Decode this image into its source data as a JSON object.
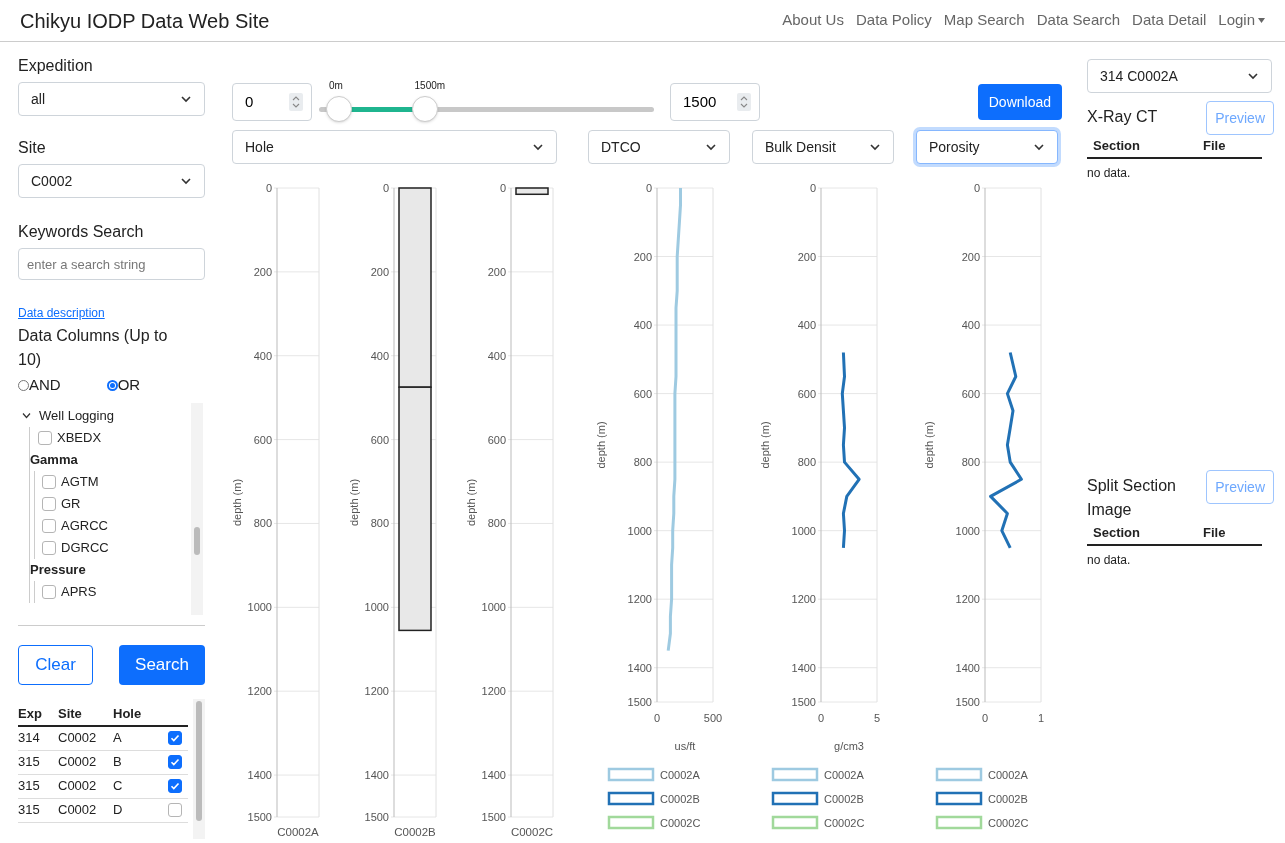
{
  "header": {
    "title": "Chikyu IODP Data Web Site",
    "nav": [
      {
        "label": "About Us",
        "kind": "link"
      },
      {
        "label": "Data Policy",
        "kind": "link"
      },
      {
        "label": "Map Search",
        "kind": "link"
      },
      {
        "label": "Data Search",
        "kind": "link"
      },
      {
        "label": "Data Detail",
        "kind": "link"
      },
      {
        "label": "Login",
        "kind": "dropdown"
      }
    ]
  },
  "filters": {
    "expedition": {
      "label": "Expedition",
      "value": "all"
    },
    "site": {
      "label": "Site",
      "value": "C0002"
    },
    "keywords": {
      "label": "Keywords Search",
      "placeholder": "enter a search string"
    },
    "description_link": "Data description",
    "columns_label": "Data Columns (Up to 10)",
    "match_modes": [
      {
        "label": "AND",
        "selected": false
      },
      {
        "label": "OR",
        "selected": true
      }
    ],
    "tree": [
      {
        "kind": "folder",
        "label": "Well Logging",
        "expanded": true,
        "children": [
          {
            "kind": "item",
            "label": "XBEDX",
            "checked": false
          },
          {
            "kind": "group",
            "label": "Gamma",
            "children": [
              {
                "kind": "item",
                "label": "AGTM",
                "checked": false
              },
              {
                "kind": "item",
                "label": "GR",
                "checked": false
              },
              {
                "kind": "item",
                "label": "AGRCC",
                "checked": false
              },
              {
                "kind": "item",
                "label": "DGRCC",
                "checked": false
              }
            ]
          },
          {
            "kind": "group",
            "label": "Pressure",
            "children": [
              {
                "kind": "item",
                "label": "APRS",
                "checked": false
              }
            ]
          }
        ]
      }
    ]
  },
  "actions": [
    {
      "label": "Clear",
      "kind": "outline"
    },
    {
      "label": "Search",
      "kind": "primary"
    }
  ],
  "results": {
    "columns": [
      "Exp",
      "Site",
      "Hole"
    ],
    "rows": [
      {
        "exp": "314",
        "site": "C0002",
        "hole": "A",
        "checked": true
      },
      {
        "exp": "315",
        "site": "C0002",
        "hole": "B",
        "checked": true
      },
      {
        "exp": "315",
        "site": "C0002",
        "hole": "C",
        "checked": true
      },
      {
        "exp": "315",
        "site": "C0002",
        "hole": "D",
        "checked": false
      }
    ]
  },
  "controls": {
    "min_depth": "0",
    "max_depth": "1500",
    "slider": {
      "thumbs": [
        {
          "label": "0m",
          "level": 0
        },
        {
          "label": "1500m",
          "level": 0.29
        }
      ]
    },
    "download": "Download"
  },
  "hole_panel": {
    "select": {
      "value": "Hole",
      "focused": false
    },
    "charts": [
      {
        "chart_data": {
          "type": "bar",
          "grid": true,
          "ylabel": "depth (m)",
          "ylim": [
            1500,
            0
          ],
          "yticks": [
            0,
            200,
            400,
            600,
            800,
            1000,
            1200,
            1400,
            1500
          ],
          "categories": [
            "C0002A"
          ],
          "series": [
            {
              "values": [
                null
              ]
            }
          ]
        }
      },
      {
        "chart_data": {
          "type": "bar",
          "stacked": true,
          "grid": true,
          "ylabel": "depth (m)",
          "ylim": [
            1500,
            0
          ],
          "yticks": [
            0,
            200,
            400,
            600,
            800,
            1000,
            1200,
            1400,
            1500
          ],
          "categories": [
            "C0002B"
          ],
          "series": [
            {
              "values": [
                475
              ]
            },
            {
              "values": [
                580
              ]
            }
          ]
        }
      },
      {
        "chart_data": {
          "type": "bar",
          "grid": true,
          "ylabel": "depth (m)",
          "ylim": [
            1500,
            0
          ],
          "yticks": [
            0,
            200,
            400,
            600,
            800,
            1000,
            1200,
            1400,
            1500
          ],
          "categories": [
            "C0002C"
          ],
          "series": [
            {
              "values": [
                15
              ]
            }
          ]
        }
      }
    ]
  },
  "log_panels": [
    {
      "select": {
        "value": "DTCO",
        "focused": false
      },
      "chart_data": {
        "type": "line",
        "grid": true,
        "orientation": "horizontal",
        "xlabel": "us/ft",
        "ylabel": "depth (m)",
        "xlim": [
          0,
          500
        ],
        "xticks": [
          0,
          500
        ],
        "ylim": [
          1500,
          0
        ],
        "yticks": [
          0,
          200,
          400,
          600,
          800,
          1000,
          1200,
          1400,
          1500
        ],
        "x": [
          0,
          50,
          100,
          150,
          200,
          250,
          300,
          350,
          400,
          450,
          500,
          550,
          600,
          650,
          700,
          750,
          800,
          850,
          900,
          950,
          1000,
          1050,
          1100,
          1150,
          1200,
          1250,
          1300,
          1350
        ],
        "series": [
          {
            "name": "C0002A",
            "color": "#9ecae1",
            "values": [
              210,
              210,
              200,
              190,
              180,
              180,
              180,
              170,
              170,
              170,
              170,
              170,
              160,
              160,
              160,
              160,
              160,
              160,
              150,
              150,
              140,
              140,
              130,
              130,
              130,
              120,
              120,
              100
            ]
          },
          {
            "name": "C0002B",
            "color": "#2171b5",
            "values": [
              null,
              null,
              null,
              null,
              null,
              null,
              null,
              null,
              null,
              null,
              null,
              null,
              null,
              null,
              null,
              null,
              null,
              null,
              null,
              null,
              null,
              null,
              null,
              null,
              null,
              null,
              null,
              null
            ]
          },
          {
            "name": "C0002C",
            "color": "#a1d99b",
            "values": [
              null,
              null,
              null,
              null,
              null,
              null,
              null,
              null,
              null,
              null,
              null,
              null,
              null,
              null,
              null,
              null,
              null,
              null,
              null,
              null,
              null,
              null,
              null,
              null,
              null,
              null,
              null,
              null
            ]
          }
        ]
      }
    },
    {
      "select": {
        "value": "Bulk Densit",
        "focused": false
      },
      "chart_data": {
        "type": "line",
        "grid": true,
        "orientation": "horizontal",
        "xlabel": "g/cm3",
        "ylabel": "depth (m)",
        "xlim": [
          0,
          5
        ],
        "xticks": [
          0,
          5
        ],
        "ylim": [
          1500,
          0
        ],
        "yticks": [
          0,
          200,
          400,
          600,
          800,
          1000,
          1200,
          1400,
          1500
        ],
        "x": [
          480,
          550,
          600,
          650,
          700,
          750,
          800,
          850,
          900,
          950,
          1000,
          1050
        ],
        "series": [
          {
            "name": "C0002A",
            "color": "#9ecae1",
            "values": [
              null,
              null,
              null,
              null,
              null,
              null,
              null,
              null,
              null,
              null,
              null,
              null
            ]
          },
          {
            "name": "C0002B",
            "color": "#2171b5",
            "values": [
              2.0,
              2.1,
              1.9,
              2.0,
              2.1,
              2.0,
              2.1,
              3.4,
              2.3,
              2.0,
              2.1,
              2.0
            ]
          },
          {
            "name": "C0002C",
            "color": "#a1d99b",
            "values": [
              null,
              null,
              null,
              null,
              null,
              null,
              null,
              null,
              null,
              null,
              null,
              null
            ]
          }
        ]
      }
    },
    {
      "select": {
        "value": "Porosity",
        "focused": true
      },
      "chart_data": {
        "type": "line",
        "grid": true,
        "orientation": "horizontal",
        "ylabel": "depth (m)",
        "xlim": [
          0,
          1
        ],
        "xticks": [
          0,
          1
        ],
        "ylim": [
          1500,
          0
        ],
        "yticks": [
          0,
          200,
          400,
          600,
          800,
          1000,
          1200,
          1400,
          1500
        ],
        "x": [
          480,
          550,
          600,
          650,
          700,
          750,
          800,
          850,
          900,
          950,
          1000,
          1050
        ],
        "series": [
          {
            "name": "C0002A",
            "color": "#9ecae1",
            "values": [
              null,
              null,
              null,
              null,
              null,
              null,
              null,
              null,
              null,
              null,
              null,
              null
            ]
          },
          {
            "name": "C0002B",
            "color": "#2171b5",
            "values": [
              0.45,
              0.55,
              0.4,
              0.5,
              0.45,
              0.4,
              0.45,
              0.65,
              0.1,
              0.4,
              0.3,
              0.45
            ]
          },
          {
            "name": "C0002C",
            "color": "#a1d99b",
            "values": [
              null,
              null,
              null,
              null,
              null,
              null,
              null,
              null,
              null,
              null,
              null,
              null
            ]
          }
        ]
      }
    }
  ],
  "right": {
    "select": "314 C0002A",
    "sections": [
      {
        "title": "X-Ray CT",
        "button": "Preview",
        "columns": [
          "Section",
          "File"
        ],
        "empty": "no data."
      },
      {
        "title": "Split Section Image",
        "button": "Preview",
        "columns": [
          "Section",
          "File"
        ],
        "empty": "no data."
      }
    ]
  }
}
